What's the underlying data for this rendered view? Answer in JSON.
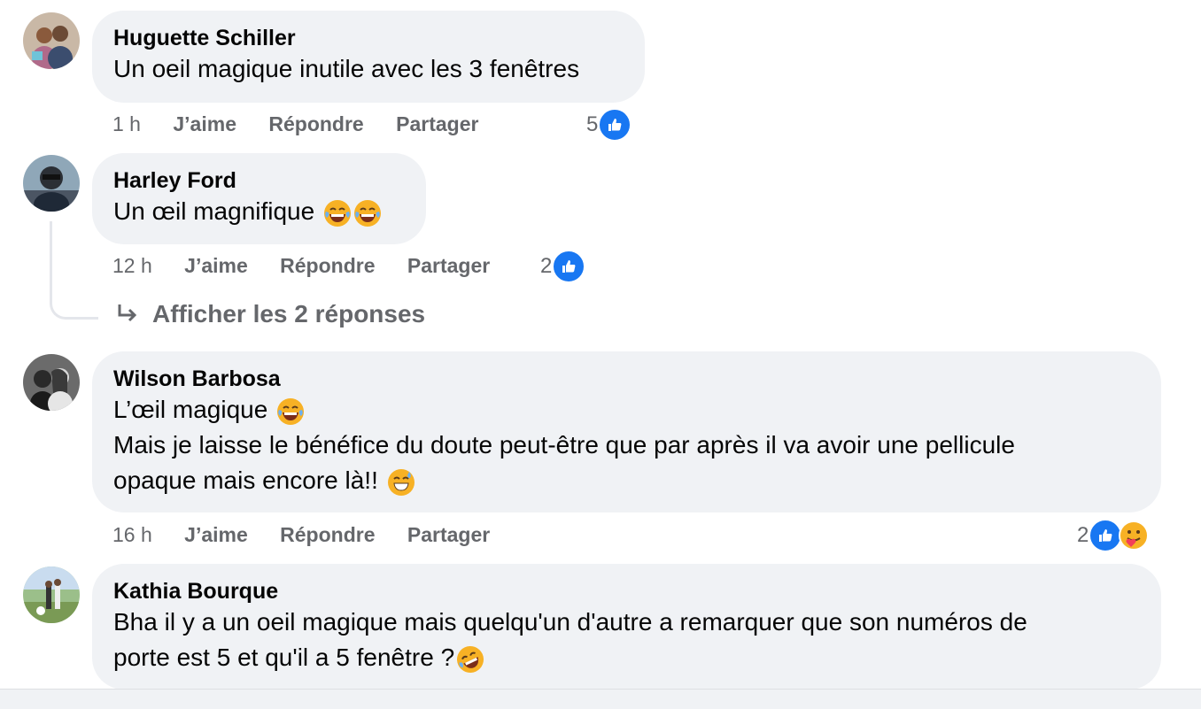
{
  "comments": [
    {
      "author": "Huguette Schiller",
      "lines": [
        "Un oeil magique inutile avec les 3 fenêtres"
      ],
      "time": "1 h",
      "like_label": "J’aime",
      "reply_label": "Répondre",
      "share_label": "Partager",
      "reaction_count": "5",
      "reactions": [
        "like-icon"
      ]
    },
    {
      "author": "Harley Ford",
      "lines": [
        "Un œil magnifique"
      ],
      "time": "12 h",
      "like_label": "J’aime",
      "reply_label": "Répondre",
      "share_label": "Partager",
      "reaction_count": "2",
      "reactions": [
        "like-icon"
      ],
      "view_replies_label": "Afficher les 2 réponses"
    },
    {
      "author": "Wilson Barbosa",
      "lines": [
        "L’œil magique",
        "Mais je laisse le bénéfice du doute peut-être que par après il va avoir une pellicule",
        "opaque mais encore là!!"
      ],
      "time": "16 h",
      "like_label": "J’aime",
      "reply_label": "Répondre",
      "share_label": "Partager",
      "reaction_count": "2",
      "reactions": [
        "like-icon",
        "care-icon"
      ]
    },
    {
      "author": "Kathia Bourque",
      "lines": [
        "Bha il y a un oeil magique mais quelqu'un d'autre a remarquer que son numéros de",
        "porte est 5 et qu'il a 5 fenêtre ?"
      ]
    }
  ],
  "colors": {
    "bubble": "#f0f2f5",
    "secondary_text": "#65676b",
    "like_blue": "#1877f2",
    "emoji_yellow": "#f7b125"
  }
}
